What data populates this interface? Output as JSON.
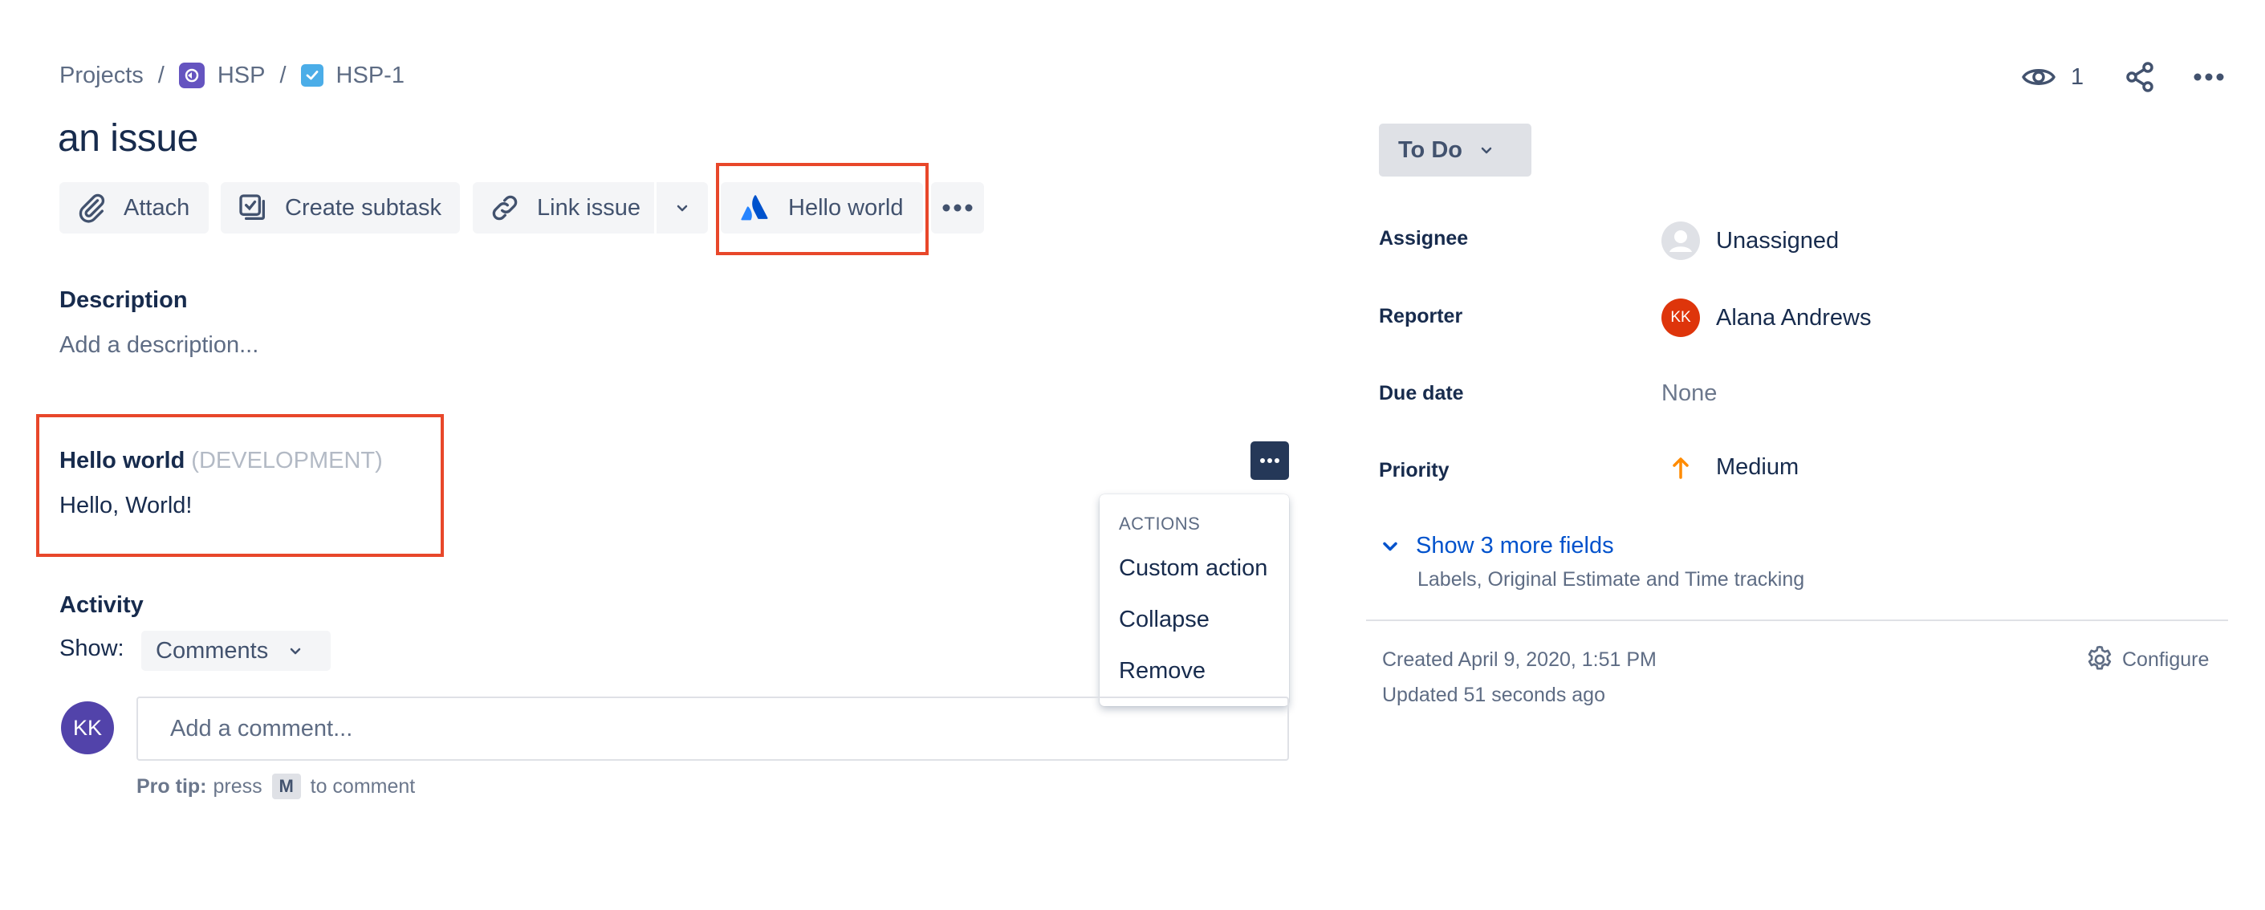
{
  "breadcrumb": {
    "projects": "Projects",
    "separator": "/",
    "project_key": "HSP",
    "issue_key": "HSP-1"
  },
  "issue": {
    "title": "an issue"
  },
  "toolbar": {
    "attach": "Attach",
    "create_subtask": "Create subtask",
    "link_issue": "Link issue",
    "hello_world": "Hello world"
  },
  "description": {
    "label": "Description",
    "placeholder": "Add a description..."
  },
  "app_panel": {
    "title": "Hello world",
    "environment": "(DEVELOPMENT)",
    "body": "Hello, World!"
  },
  "actions_menu": {
    "heading": "ACTIONS",
    "items": [
      "Custom action",
      "Collapse",
      "Remove"
    ]
  },
  "activity": {
    "label": "Activity",
    "show_label": "Show:",
    "show_value": "Comments",
    "avatar_initials": "KK",
    "comment_placeholder": "Add a comment...",
    "pro_tip_label": "Pro tip:",
    "pro_tip_press": "press",
    "pro_tip_key": "M",
    "pro_tip_suffix": "to comment"
  },
  "header_actions": {
    "watchers": "1"
  },
  "status": {
    "label": "To Do"
  },
  "fields": {
    "assignee_label": "Assignee",
    "assignee_value": "Unassigned",
    "reporter_label": "Reporter",
    "reporter_initials": "KK",
    "reporter_value": "Alana Andrews",
    "due_label": "Due date",
    "due_value": "None",
    "priority_label": "Priority",
    "priority_value": "Medium"
  },
  "more_fields": {
    "label": "Show 3 more fields",
    "sub": "Labels, Original Estimate and Time tracking"
  },
  "meta": {
    "created": "Created April 9, 2020, 1:51 PM",
    "updated": "Updated 51 seconds ago",
    "configure": "Configure"
  },
  "colors": {
    "highlight": "#e8472a",
    "link": "#0052cc",
    "priority_medium": "#ff8b00",
    "reporter_avatar": "#de350b",
    "user_avatar": "#5243aa"
  }
}
